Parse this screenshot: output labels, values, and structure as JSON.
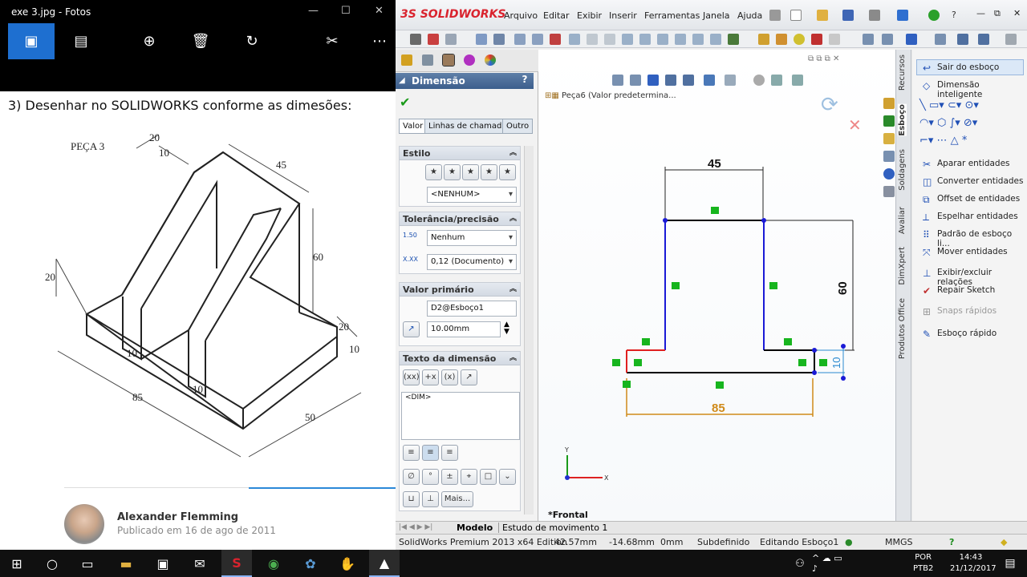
{
  "photos": {
    "title": "exe 3.jpg - Fotos",
    "heading": "3) Desenhar no SOLIDWORKS conforme as dimesões:",
    "drawing": {
      "label": "PEÇA 3",
      "dims": [
        "20",
        "10",
        "45",
        "60",
        "20",
        "20",
        "10",
        "10",
        "10",
        "85",
        "50"
      ]
    },
    "author": "Alexander Flemming",
    "published": "Publicado em 16 de ago de 2011",
    "toolbar_icons": [
      "picture-icon",
      "slideshow-icon",
      "zoom-icon",
      "delete-icon",
      "rotate-icon",
      "edit-icon",
      "more-icon"
    ]
  },
  "solidworks": {
    "logo": "SOLIDWORKS",
    "menu": [
      "Arquivo",
      "Editar",
      "Exibir",
      "Inserir",
      "Ferramentas",
      "Janela",
      "Ajuda"
    ],
    "pm": {
      "title": "Dimensão",
      "help": "?",
      "tabs": [
        "Valor",
        "Linhas de chamada",
        "Outro"
      ],
      "estilo": {
        "title": "Estilo",
        "value": "<NENHUM>"
      },
      "tolerancia": {
        "title": "Tolerância/precisão",
        "tol": "Nenhum",
        "prec": "0,12 (Documento)"
      },
      "valor": {
        "title": "Valor primário",
        "name": "D2@Esboço1",
        "value": "10.00mm"
      },
      "texto": {
        "title": "Texto da dimensão",
        "text": "<DIM>",
        "more": "Mais..."
      }
    },
    "tree": {
      "part": "Peça6  (Valor predetermina..."
    },
    "sketch": {
      "dims": [
        "45",
        "60",
        "10",
        "85"
      ],
      "view": "*Frontal"
    },
    "command_manager": {
      "tabs": [
        "Recursos",
        "Esboço",
        "Soldagens",
        "Avaliar",
        "DimXpert",
        "Produtos Office"
      ],
      "items": [
        "Sair do esboço",
        "Dimensão inteligente",
        "Aparar entidades",
        "Converter entidades",
        "Offset de entidades",
        "Espelhar entidades",
        "Padrão de esboço li...",
        "Mover entidades",
        "Exibir/excluir relações",
        "Repair Sketch",
        "Snaps rápidos",
        "Esboço rápido"
      ]
    },
    "bottom_tabs": [
      "Modelo",
      "Estudo de movimento 1"
    ],
    "status": {
      "edition": "SolidWorks Premium 2013 x64 Edition",
      "x": "42.57mm",
      "y": "-14.68mm",
      "z": "0mm",
      "state": "Subdefinido",
      "editing": "Editando Esboço1",
      "units": "MMGS"
    }
  },
  "taskbar": {
    "lang": "POR",
    "layout": "PTB2",
    "time": "14:43",
    "date": "21/12/2017"
  },
  "colors": {
    "sw_red": "#d9232e",
    "sketch_blue": "#1a1ad6",
    "dim_orange": "#d08a1a"
  }
}
